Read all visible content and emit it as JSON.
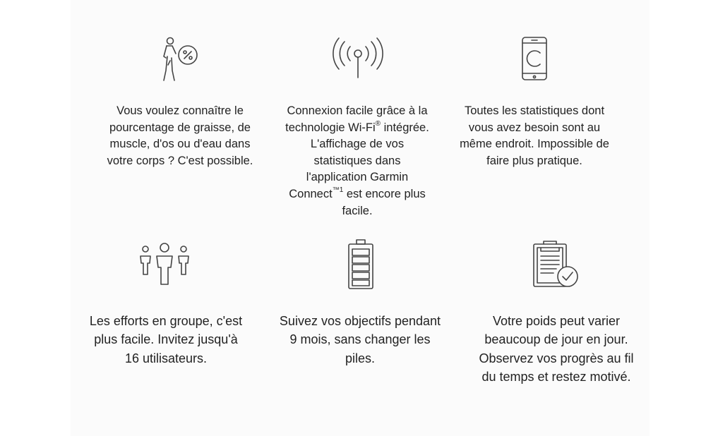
{
  "features": [
    {
      "icon": "body-composition-icon",
      "lines": [
        "Vous voulez connaître le",
        "pourcentage de graisse, de",
        "muscle, d'os ou d'eau dans",
        "votre corps ? C'est possible."
      ]
    },
    {
      "icon": "wifi-signal-icon",
      "line1": "Connexion facile grâce à la",
      "line2a": "technologie Wi-Fi",
      "line2sup": "®",
      "line2b": " intégrée.",
      "line3": "L'affichage de vos",
      "line4": "statistiques dans",
      "line5": "l'application Garmin",
      "line6a": "Connect",
      "line6sup": "™1",
      "line6b": " est encore plus",
      "line7": "facile."
    },
    {
      "icon": "smartphone-icon",
      "lines": [
        "Toutes les statistiques dont",
        "vous avez besoin sont au",
        "même endroit. Impossible de",
        "faire plus pratique."
      ]
    },
    {
      "icon": "group-users-icon",
      "lines": [
        "Les efforts en groupe, c'est",
        "plus facile. Invitez jusqu'à",
        "16 utilisateurs."
      ]
    },
    {
      "icon": "battery-icon",
      "lines": [
        "Suivez vos objectifs pendant",
        "9 mois, sans changer les",
        "piles."
      ]
    },
    {
      "icon": "clipboard-check-icon",
      "lines": [
        "Votre poids peut varier",
        "beaucoup de jour en jour.",
        "Observez vos progrès au fil",
        "du temps et restez motivé."
      ]
    }
  ]
}
